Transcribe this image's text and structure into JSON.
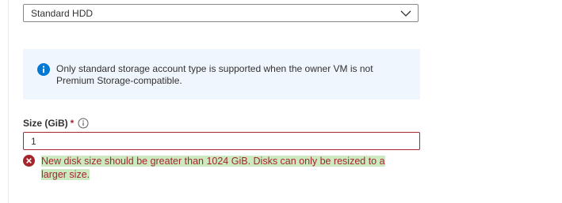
{
  "storage_type": {
    "selected_value": "Standard HDD",
    "icon": "chevron-down-icon"
  },
  "info_message": {
    "text": "Only standard storage account type is supported when the owner VM is not Premium Storage-compatible.",
    "icon": "info-icon",
    "icon_color": "#0078d4",
    "background_color": "#f0f6fd"
  },
  "size_field": {
    "label": "Size (GiB)",
    "required_marker": "*",
    "info_icon": "info-circle-icon",
    "value": "1"
  },
  "validation_error": {
    "text": "New disk size should be greater than 1024 GiB. Disks can only be resized to a larger size.",
    "icon": "error-icon",
    "color": "#a4262c",
    "highlight_color": "#cde9c1"
  }
}
